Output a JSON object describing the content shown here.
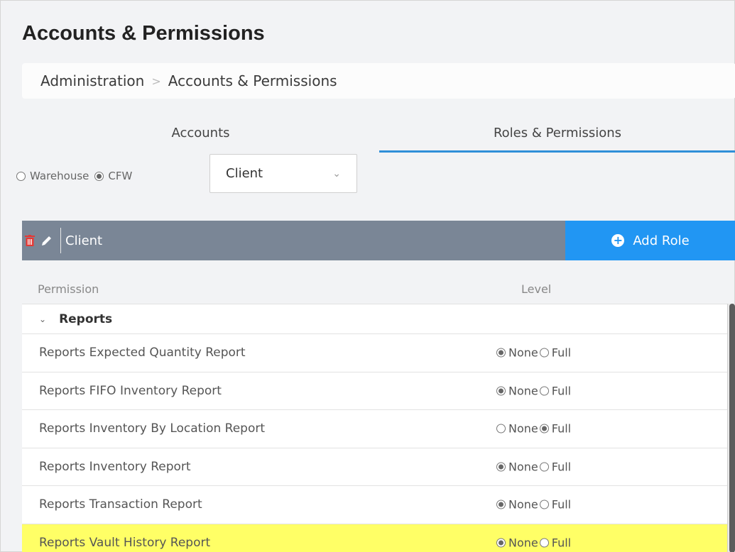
{
  "page": {
    "title": "Accounts & Permissions"
  },
  "breadcrumb": {
    "items": [
      "Administration",
      "Accounts & Permissions"
    ],
    "separator": ">"
  },
  "tabs": [
    {
      "label": "Accounts",
      "active": false
    },
    {
      "label": "Roles & Permissions",
      "active": true
    }
  ],
  "filter": {
    "options": [
      {
        "label": "Warehouse",
        "selected": false
      },
      {
        "label": "CFW",
        "selected": true
      }
    ],
    "role_select": {
      "value": "Client"
    }
  },
  "role_bar": {
    "role_name": "Client",
    "add_role_label": "Add Role",
    "colors": {
      "bar": "#7a8696",
      "add_button": "#2196f3",
      "trash": "#e53935"
    },
    "icons": [
      "trash-icon",
      "pencil-icon",
      "plus-circle-icon"
    ]
  },
  "permissions": {
    "col_permission": "Permission",
    "col_level": "Level",
    "group": "Reports",
    "level_labels": {
      "none": "None",
      "full": "Full"
    },
    "rows": [
      {
        "name": "Reports Expected Quantity Report",
        "level": "none",
        "highlighted": false
      },
      {
        "name": "Reports FIFO Inventory Report",
        "level": "none",
        "highlighted": false
      },
      {
        "name": "Reports Inventory By Location Report",
        "level": "full",
        "highlighted": false
      },
      {
        "name": "Reports Inventory Report",
        "level": "none",
        "highlighted": false
      },
      {
        "name": "Reports Transaction Report",
        "level": "none",
        "highlighted": false
      },
      {
        "name": "Reports Vault History Report",
        "level": "none",
        "highlighted": true
      }
    ]
  }
}
